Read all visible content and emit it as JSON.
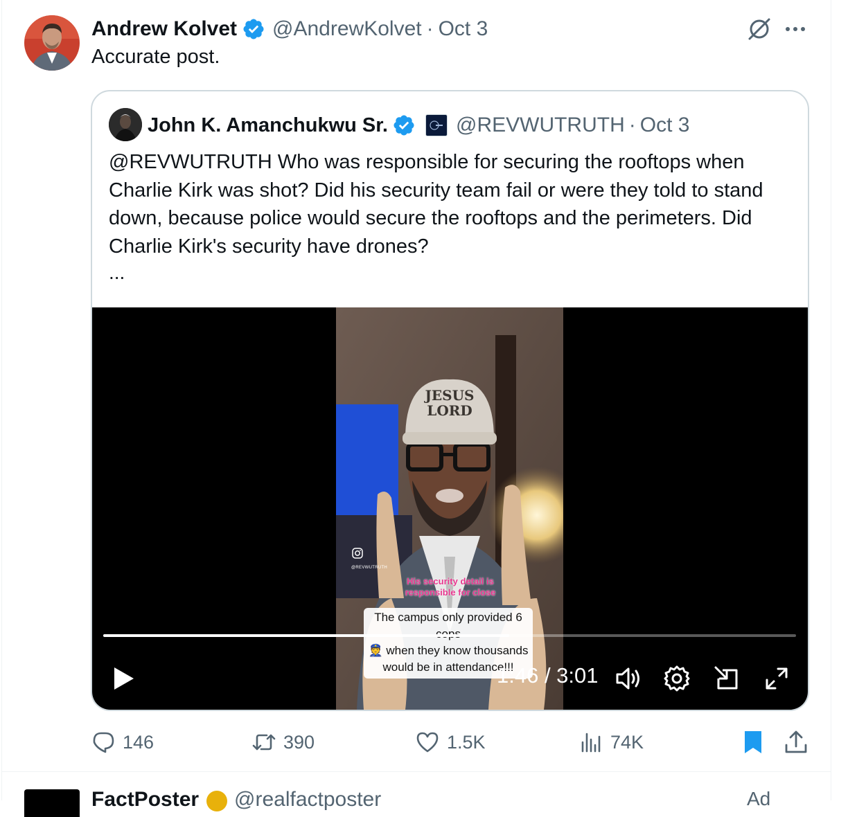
{
  "post": {
    "author_name": "Andrew Kolvet",
    "author_handle": "@AndrewKolvet",
    "separator": "·",
    "date": "Oct 3",
    "text": "Accurate post.",
    "icons": {
      "verified": "verified-badge-icon",
      "grok": "grok-icon",
      "more": "more-icon"
    }
  },
  "quoted": {
    "author_name": "John K. Amanchukwu Sr.",
    "author_handle": "@REVWUTRUTH",
    "date": "Oct 3",
    "text": "@REVWUTRUTH Who was responsible for securing the rooftops when Charlie Kirk was shot? Did his security team fail or were they told to stand down, because police would secure the rooftops and the perimeters. Did Charlie Kirk's security have drones?",
    "ellipsis": "..."
  },
  "video": {
    "hat_text_1": "JESUS",
    "hat_text_2": "LORD",
    "ig_handle": "@REVWUTRUTH",
    "pink_caption_1": "His security detail is",
    "pink_caption_2": "responsible for close",
    "caption_line_1": "The campus only provided 6 cops",
    "caption_line_2": "when they know thousands",
    "caption_line_3": "would be in attendance!!!",
    "current_time": "1:46",
    "duration": "3:01",
    "time_display": "1:46 / 3:01",
    "progress": 0.586,
    "controls": [
      "play-icon",
      "volume-icon",
      "settings-icon",
      "pip-icon",
      "fullscreen-icon"
    ]
  },
  "actions": {
    "replies": "146",
    "reposts": "390",
    "likes": "1.5K",
    "views": "74K",
    "bookmark_color": "#1d9bf0",
    "muted_color": "#536471"
  },
  "next_post": {
    "author_name": "FactPoster",
    "author_handle": "@realfactposter",
    "label": "Ad"
  },
  "colors": {
    "accent": "#1d9bf0",
    "text": "#0f1419",
    "muted": "#536471",
    "border": "#cfd9de"
  }
}
